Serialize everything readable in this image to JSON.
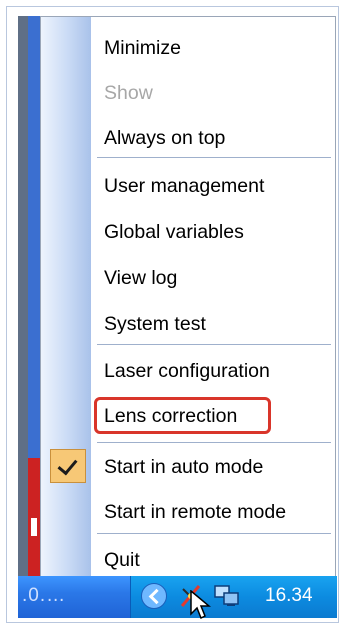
{
  "menu": {
    "items": [
      {
        "label": "Minimize",
        "enabled": true
      },
      {
        "label": "Show",
        "enabled": false
      },
      {
        "label": "Always on top",
        "enabled": true
      },
      {
        "label": "User management",
        "enabled": true
      },
      {
        "label": "Global variables",
        "enabled": true
      },
      {
        "label": "View log",
        "enabled": true
      },
      {
        "label": "System test",
        "enabled": true
      },
      {
        "label": "Laser configuration",
        "enabled": true
      },
      {
        "label": "Lens correction",
        "enabled": true,
        "highlighted": true
      },
      {
        "label": "Start in auto mode",
        "enabled": true,
        "checked": true
      },
      {
        "label": "Start in remote mode",
        "enabled": true
      },
      {
        "label": "Quit",
        "enabled": true
      }
    ]
  },
  "taskbar": {
    "task_text": ".0.…",
    "clock": "16.34"
  },
  "colors": {
    "highlight_border": "#d9352a",
    "check_background": "#f7c876",
    "taskbar_blue": "#2b78e8",
    "tray_blue": "#0c8be0"
  },
  "icons": [
    "checkmark-icon",
    "chevron-left-icon",
    "network-icon",
    "monitor-icon",
    "mouse-cursor-icon"
  ]
}
